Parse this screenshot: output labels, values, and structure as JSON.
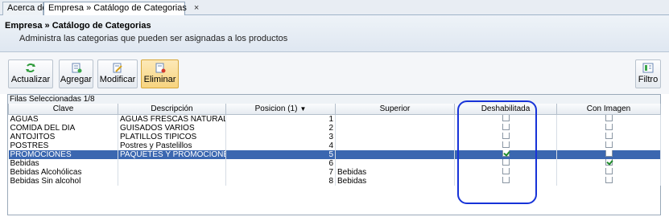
{
  "tabs": [
    {
      "label": "Acerca de"
    },
    {
      "label": "Empresa » Catálogo de Categorias",
      "close": "×"
    }
  ],
  "header": {
    "title": "Empresa » Catálogo de Categorias",
    "subtitle": "Administra las categorias que pueden ser asignadas a los productos"
  },
  "toolbar": {
    "actualizar": "Actualizar",
    "agregar": "Agregar",
    "modificar": "Modificar",
    "eliminar": "Eliminar",
    "filtro": "Filtro"
  },
  "grid": {
    "caption": "Filas Seleccionadas  1/8",
    "columns": [
      "Clave",
      "Descripción",
      "Posicion (1)",
      "Superior",
      "Deshabilitada",
      "Con Imagen"
    ],
    "sort_indicator": "▼",
    "rows": [
      {
        "clave": "AGUAS",
        "descripcion": "AGUAS FRESCAS NATURALES",
        "posicion": "1",
        "superior": "",
        "deshabilitada": false,
        "con_imagen": false
      },
      {
        "clave": "COMIDA DEL DIA",
        "descripcion": "GUISADOS VARIOS",
        "posicion": "2",
        "superior": "",
        "deshabilitada": false,
        "con_imagen": false
      },
      {
        "clave": "ANTOJITOS",
        "descripcion": "PLATILLOS TIPICOS",
        "posicion": "3",
        "superior": "",
        "deshabilitada": false,
        "con_imagen": false
      },
      {
        "clave": "POSTRES",
        "descripcion": "Postres y Pastelillos",
        "posicion": "4",
        "superior": "",
        "deshabilitada": false,
        "con_imagen": false
      },
      {
        "clave": "PROMOCIONES",
        "descripcion": "PAQUETES Y PROMOCIONES",
        "posicion": "5",
        "superior": "",
        "deshabilitada": true,
        "con_imagen": false,
        "selected": true
      },
      {
        "clave": "Bebidas",
        "descripcion": "",
        "posicion": "6",
        "superior": "",
        "deshabilitada": false,
        "con_imagen": true
      },
      {
        "clave": "Bebidas Alcohólicas",
        "descripcion": "",
        "posicion": "7",
        "superior": "Bebidas",
        "deshabilitada": false,
        "con_imagen": false
      },
      {
        "clave": "Bebidas Sin alcohol",
        "descripcion": "",
        "posicion": "8",
        "superior": "Bebidas",
        "deshabilitada": false,
        "con_imagen": false
      }
    ]
  },
  "colors": {
    "selection": "#3b67b0",
    "highlight_outline": "#1733d8",
    "active_button": "#f7d47f"
  },
  "icons": [
    "refresh-icon",
    "add-icon",
    "edit-icon",
    "delete-icon",
    "filter-icon",
    "close-icon",
    "sort-down-icon",
    "checkbox-icon"
  ]
}
